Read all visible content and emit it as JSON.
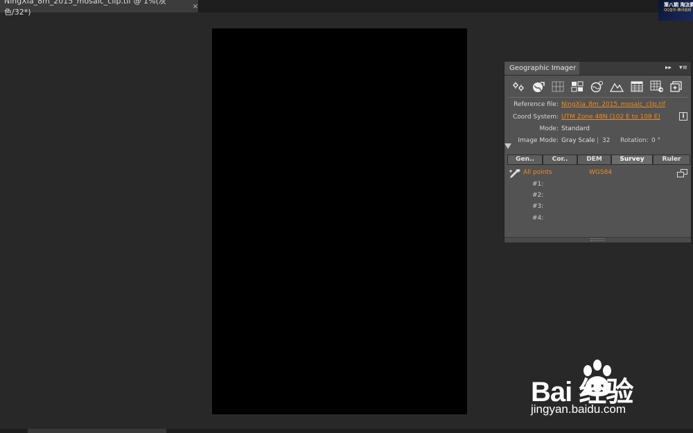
{
  "document": {
    "tab_title": "NingXia_8m_2015_mosaic_clip.tif @ 1%(灰色/32*)",
    "close_glyph": "×"
  },
  "thumbnail": {
    "line1": "第八期 淘汰赛",
    "line2": "QQ音乐·腾讯视频"
  },
  "panel": {
    "title": "Geographic Imager",
    "expand_glyph": "▸▸",
    "menu_glyph": "▾≡",
    "toolbar_icons": [
      "transform-icon",
      "globe-arrow-icon",
      "grid-icon",
      "tiles-icon",
      "globe-settings-icon",
      "terrain-icon",
      "table-icon",
      "table-export-icon",
      "add-layer-icon"
    ],
    "fields": {
      "reference_label": "Reference file:",
      "reference_value": "NingXia_8m_2015_mosaic_clip.tif",
      "coord_label": "Coord System:",
      "coord_value": "UTM Zone 48N (102 E to 108 E)",
      "mode_label": "Mode:",
      "mode_value": "Standard",
      "image_mode_label": "Image Mode:",
      "image_mode_value": "Gray Scale",
      "bit_depth": "32",
      "rotation_label": "Rotation:",
      "rotation_value": "0 °"
    },
    "info_glyph": "i",
    "subtabs": [
      "Gen..",
      "Cor..",
      "DEM",
      "Survey",
      "Ruler"
    ],
    "active_subtab": "Survey",
    "survey": {
      "all_points": "All points",
      "datum": "WGS84",
      "points": [
        "#1:",
        "#2:",
        "#3:",
        "#4:"
      ]
    }
  },
  "watermark": {
    "brand": "Bai  经验",
    "url": "jingyan.baidu.com"
  },
  "colors": {
    "accent": "#f08c1e",
    "panel_bg": "#535353",
    "workspace_bg": "#282828",
    "canvas_bg": "#000000"
  }
}
